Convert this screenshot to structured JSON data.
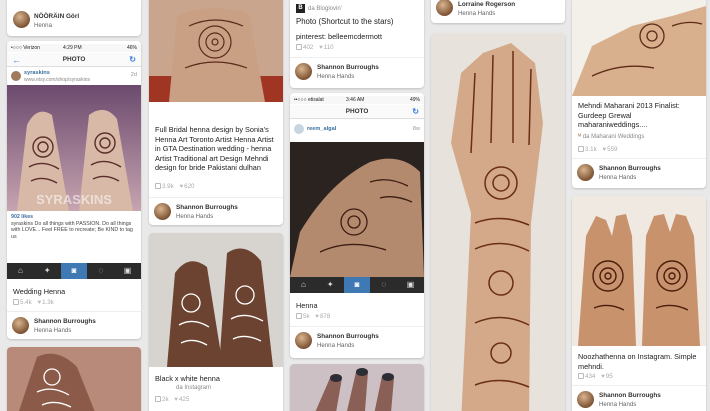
{
  "col1": {
    "top_card": {
      "board": "Henna",
      "pinner": "NÖÖRÄIN Görl"
    },
    "wedding_pin": {
      "status": {
        "carrier": "•○○○ Verizon",
        "time": "4:29 PM",
        "battery": "46%"
      },
      "nav_title": "PHOTO",
      "user": "syraskins",
      "url": "www.etsy.com/shop/syraskins",
      "age": "2d",
      "watermark": "SYRASKINS",
      "likes": "902 likes",
      "caption": "syraskins Do all things with PASSION. Do all things with LOVE... Feel FREE to recreate; Be KIND to tag us",
      "title": "Wedding Henna",
      "repins": "5.4k",
      "likes_count": "1.3k",
      "pinner": "Shannon Burroughs",
      "board": "Henna Hands"
    }
  },
  "col2": {
    "bridal_pin": {
      "title": "Full Bridal henna design by Sonia's Henna Art Toronto Artist Henna Artist in GTA Destination wedding - henna Artist Traditional art Design Mehndi design for bride Pakistani dulhan",
      "repins": "3.9k",
      "likes": "620",
      "pinner": "Shannon Burroughs",
      "board": "Henna Hands"
    },
    "white_pin": {
      "title": "Black x white henna",
      "repins": "2k",
      "likes": "425",
      "via": "da Instagram"
    }
  },
  "col3": {
    "bloglovin_pin": {
      "source": "da Bloglovin'",
      "title": "Photo (Shortcut to the stars)",
      "desc": "pinterest: belleemcdermott",
      "repins": "402",
      "likes": "110",
      "pinner": "Shannon Burroughs",
      "board": "Henna Hands"
    },
    "henna_pin": {
      "status": {
        "carrier": "••○○○ etisalat",
        "time": "3:46 AM",
        "battery": "49%"
      },
      "nav_title": "PHOTO",
      "user": "reem_algal",
      "age": "8w",
      "title": "Henna",
      "repins": "5k",
      "likes": "878",
      "pinner": "Shannon Burroughs",
      "board": "Henna Hands"
    }
  },
  "col4": {
    "top_card": {
      "pinner": "Lorraine Rogerson",
      "board": "Henna Hands"
    }
  },
  "col5": {
    "maharani_pin": {
      "title": "Mehndi Maharani 2013 Finalist: Gurdeep Grewal maharaniweddings....",
      "source": "da Maharani Weddings",
      "repins": "3.1k",
      "likes": "559",
      "pinner": "Shannon Burroughs",
      "board": "Henna Hands"
    },
    "noozhat_pin": {
      "title": "Noozhathenna on Instagram. Simple mehndi.",
      "repins": "434",
      "likes": "95",
      "pinner": "Shannon Burroughs",
      "board": "Henna Hands"
    }
  }
}
